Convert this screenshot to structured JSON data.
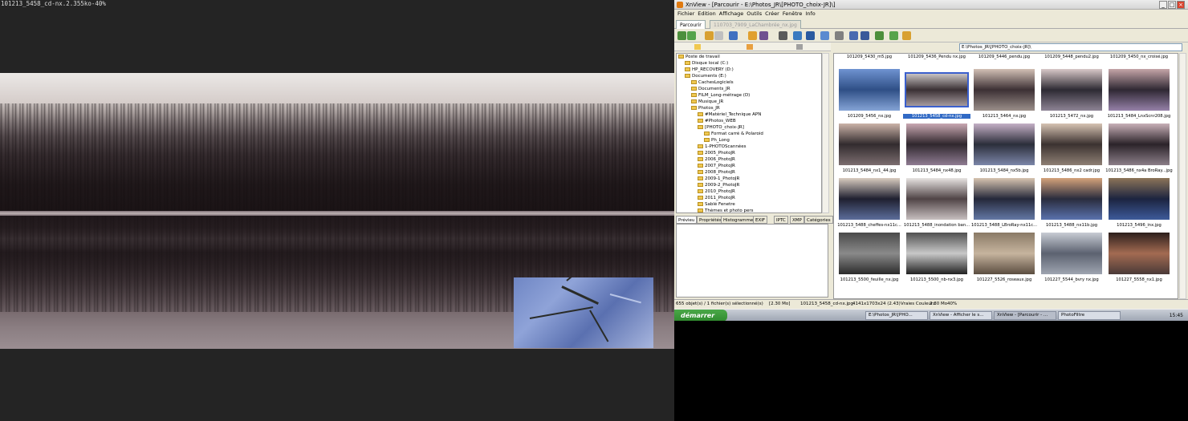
{
  "viewer_caption": "101213_5458_cd-nx.2.355ko-40%",
  "app": {
    "title": "XnView - [Parcourir - E:\\Photos_JR\\[PHOTO_choix-JR]\\]",
    "menu": [
      "Fichier",
      "Edition",
      "Affichage",
      "Outils",
      "Créer",
      "Fenêtre",
      "Info"
    ],
    "tabs": [
      "Parcourir",
      "110703_7909_LaChambrée_nx.jpg"
    ],
    "address": "E:\\Photos_JR\\[PHOTO_choix-JR]\\"
  },
  "tree": [
    {
      "label": "Poste de travail",
      "depth": 0
    },
    {
      "label": "Disque local (C:)",
      "depth": 1
    },
    {
      "label": "HP_RECOVERY (D:)",
      "depth": 1
    },
    {
      "label": "Documents (E:)",
      "depth": 1
    },
    {
      "label": "CachesLogiciels",
      "depth": 2
    },
    {
      "label": "Documents_JR",
      "depth": 2
    },
    {
      "label": "FILM_Long-métrage (D)",
      "depth": 2
    },
    {
      "label": "Musique_JR",
      "depth": 2
    },
    {
      "label": "Photos_JR",
      "depth": 2
    },
    {
      "label": "#Matériel_Technique APN",
      "depth": 3
    },
    {
      "label": "#Photos_WEB",
      "depth": 3
    },
    {
      "label": "[PHOTO_choix-JR]",
      "depth": 3
    },
    {
      "label": "Format carré & Polaroid",
      "depth": 4
    },
    {
      "label": "Ph_Long",
      "depth": 4
    },
    {
      "label": "1-PHOTOScannées",
      "depth": 3
    },
    {
      "label": "2005_PhotoJR",
      "depth": 3
    },
    {
      "label": "2006_PhotoJR",
      "depth": 3
    },
    {
      "label": "2007_PhotoJR",
      "depth": 3
    },
    {
      "label": "2008_PhotoJR",
      "depth": 3
    },
    {
      "label": "2009-1_PhotoJR",
      "depth": 3
    },
    {
      "label": "2009-2_PhotoJR",
      "depth": 3
    },
    {
      "label": "2010_PhotoJR",
      "depth": 3
    },
    {
      "label": "2011_PhotoJR",
      "depth": 3
    },
    {
      "label": "Sablé Fenetre",
      "depth": 3
    },
    {
      "label": "Thèmes et photo pers",
      "depth": 3
    }
  ],
  "info_tabs": [
    "Prévieu",
    "Propriétés",
    "Histogramme",
    "EXIF",
    "IPTC",
    "XMP",
    "Catégories"
  ],
  "top_row": [
    "101209_5430_m5.jpg",
    "101209_5436_Pendu nx.jpg",
    "101209_5446_pendu.jpg",
    "101209_5448_pendu2.jpg",
    "101209_5450_nx_croisé.jpg"
  ],
  "thumbnails": [
    {
      "caption": "101209_5456_nx.jpg",
      "colors": [
        "#6f93d1",
        "#2f4f86",
        "#85a4d6"
      ]
    },
    {
      "caption": "101213_5458_cd-nx.jpg",
      "colors": [
        "#c9c4c4",
        "#3a3034",
        "#a59a9e"
      ],
      "selected": true
    },
    {
      "caption": "101213_5464_nx.jpg",
      "colors": [
        "#d2c0b5",
        "#3c3034",
        "#9b8f8a"
      ]
    },
    {
      "caption": "101213_5472_nx.jpg",
      "colors": [
        "#d8c8c8",
        "#2d2a33",
        "#8e8495"
      ]
    },
    {
      "caption": "101213_5484_LnxScnr208.jpg",
      "colors": [
        "#c5a5a8",
        "#2f2833",
        "#9681a8"
      ]
    },
    {
      "caption": "101213_5484_nx1_44.jpg",
      "colors": [
        "#cbb3a8",
        "#322b2e",
        "#7c6e70"
      ]
    },
    {
      "caption": "101213_5484_nx48.jpg",
      "colors": [
        "#c9a8b2",
        "#2f272d",
        "#8f7c92"
      ]
    },
    {
      "caption": "101213_5484_nx5b.jpg",
      "colors": [
        "#c4b0c6",
        "#2b2e3a",
        "#7c86a8"
      ]
    },
    {
      "caption": "101213_5486_nx2 cadr.jpg",
      "colors": [
        "#d6c3b3",
        "#3b3230",
        "#8e7f74"
      ]
    },
    {
      "caption": "101213_5486_nx4a BroRay...jpg",
      "colors": [
        "#c8b0b8",
        "#2b2329",
        "#8b7e88"
      ]
    },
    {
      "caption": "101213_5488_cheffes-nx11c...",
      "colors": [
        "#d9ccc0",
        "#1f2030",
        "#5c6d9a"
      ]
    },
    {
      "caption": "101213_5488_inondation ban...",
      "colors": [
        "#e8e4e2",
        "#504446",
        "#c7bfbf"
      ]
    },
    {
      "caption": "101213_5488_LBroRay-nx11c...",
      "colors": [
        "#d7c4b0",
        "#25283a",
        "#6378a4"
      ]
    },
    {
      "caption": "101213_5488_nx11b.jpg",
      "colors": [
        "#d4a27a",
        "#2a2c3d",
        "#5a72ad"
      ]
    },
    {
      "caption": "101213_5496_inx.jpg",
      "colors": [
        "#8c7458",
        "#1c2440",
        "#3d5a9a"
      ]
    },
    {
      "caption": "101213_5500_feuille_nx.jpg",
      "colors": [
        "#4a4a4a",
        "#8a8a8a",
        "#2b2b2b"
      ]
    },
    {
      "caption": "101213_5500_nb-nx3.jpg",
      "colors": [
        "#505050",
        "#c8c8c8",
        "#222222"
      ]
    },
    {
      "caption": "101227_5526_roseaux.jpg",
      "colors": [
        "#8a7a66",
        "#c6b49e",
        "#5b4d40"
      ]
    },
    {
      "caption": "101227_5544_bvry nx.jpg",
      "colors": [
        "#c8ccd4",
        "#5c6270",
        "#9ea4b0"
      ]
    },
    {
      "caption": "101227_5558_nx1.jpg",
      "colors": [
        "#2c1f1c",
        "#a36b52",
        "#4a3a38"
      ]
    }
  ],
  "status": {
    "count": "655 objet(s) / 1 fichier(s) sélectionné(s)",
    "size": "[2.30 Mo]",
    "file": "101213_5458_cd-nx.jpg",
    "dims": "4141x1703x24 (2.43)",
    "color": "Vraies Couleurs",
    "filesize": "2.30 Mo",
    "zoom": "40%"
  },
  "taskbar": {
    "start": "démarrer",
    "tasks": [
      "E:\\Photos_JR\\[PHO...",
      "XnView - Afficher le s...",
      "XnView - [Parcourir - ...",
      "PhotoFiltre"
    ],
    "clock": "15:45"
  }
}
